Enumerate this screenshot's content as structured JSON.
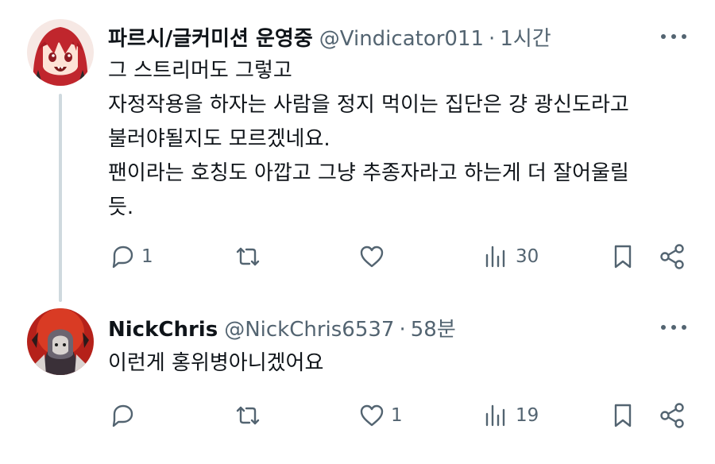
{
  "tweets": [
    {
      "display_name": "파르시/글커미션 운영중",
      "handle": "@Vindicator011",
      "separator": "·",
      "time": "1시간",
      "lines": [
        "그 스트리머도 그렇고",
        "자정작용을 하자는 사람을 정지 먹이는 집단은 걍 광신도라고",
        "불러야될지도 모르겠네요.",
        "팬이라는 호칭도 아깝고 그냥 추종자라고 하는게 더 잘어울릴",
        "듯."
      ],
      "replies": "1",
      "retweets": "",
      "likes": "",
      "views": "30",
      "avatar_colors": {
        "hair": "#c0262d",
        "skin": "#fde3d6",
        "bg": "#f6e8e4"
      }
    },
    {
      "display_name": "NickChris",
      "handle": "@NickChris6537",
      "separator": "·",
      "time": "58분",
      "lines": [
        "이런게 홍위병아니겠어요"
      ],
      "replies": "",
      "retweets": "",
      "likes": "1",
      "views": "19",
      "avatar_colors": {
        "bg": "#b5211a",
        "figure": "#d9d3d0"
      }
    }
  ],
  "icons": {
    "reply": "reply-icon",
    "retweet": "retweet-icon",
    "like": "heart-icon",
    "views": "views-icon",
    "bookmark": "bookmark-icon",
    "share": "share-icon",
    "more": "more-icon"
  }
}
